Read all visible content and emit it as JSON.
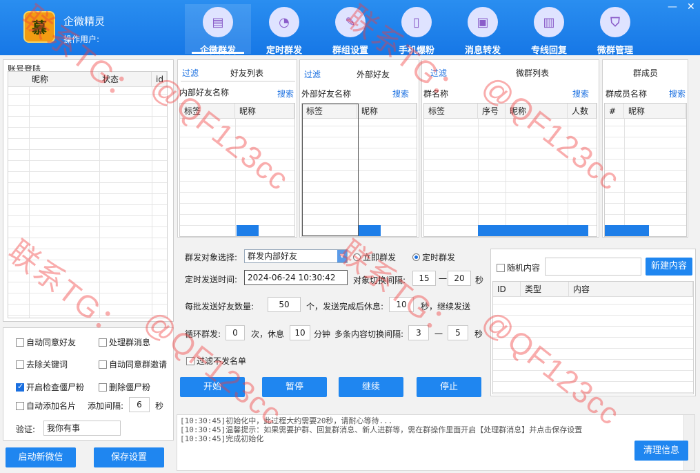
{
  "app": {
    "title": "企微精灵",
    "operator_label": "操作用户:",
    "logo_char": "慕"
  },
  "nav": [
    {
      "label": "企微群发",
      "icon": "phone-message-icon"
    },
    {
      "label": "定时群发",
      "icon": "clock-chart-icon"
    },
    {
      "label": "群组设置",
      "icon": "edit-document-icon"
    },
    {
      "label": "手机爆粉",
      "icon": "mobile-phone-icon"
    },
    {
      "label": "消息转发",
      "icon": "safe-box-icon"
    },
    {
      "label": "专线回复",
      "icon": "bar-chart-icon"
    },
    {
      "label": "微群管理",
      "icon": "shield-icon"
    }
  ],
  "window": {
    "minimize": "—",
    "close": "✕"
  },
  "accounts": {
    "title": "账号登陆",
    "columns": [
      "昵称",
      "状态",
      "id"
    ]
  },
  "options": {
    "auto_accept_friend": "自动同意好友",
    "handle_group_msg": "处理群消息",
    "remove_keywords": "去除关键词",
    "auto_accept_group": "自动同意群邀请",
    "check_zombie": "开启检查僵尸粉",
    "delete_zombie": "删除僵尸粉",
    "auto_add_card": "自动添加名片",
    "add_interval_label": "添加间隔:",
    "add_interval_value": "6",
    "add_interval_unit": "秒",
    "verify_label": "验证:",
    "verify_value": "我你有事",
    "start_wechat": "启动新微信",
    "save_settings": "保存设置"
  },
  "friends_panel": {
    "filter": "过滤",
    "title": "好友列表",
    "search_label": "内部好友名称",
    "search_btn": "搜索",
    "columns": [
      "标签",
      "昵称"
    ]
  },
  "external_panel": {
    "filter": "过滤",
    "title": "外部好友",
    "search_label": "外部好友名称",
    "search_btn": "搜索",
    "columns": [
      "标签",
      "昵称"
    ]
  },
  "groups_panel": {
    "filter": "过滤",
    "title": "微群列表",
    "search_label": "群名称",
    "search_btn": "搜索",
    "columns": [
      "标签",
      "序号",
      "昵称",
      "人数"
    ]
  },
  "members_panel": {
    "title": "群成员",
    "search_label": "群成员名称",
    "search_btn": "搜索",
    "columns": [
      "#",
      "昵称"
    ]
  },
  "send": {
    "target_label": "群发对象选择:",
    "target_value": "群发内部好友",
    "mode_now": "立即群发",
    "mode_timed": "定时群发",
    "timed_label": "定时发送时间:",
    "timed_value": "2024-06-24 10:30:42",
    "switch_label": "对象切换间隔:",
    "switch_min": "15",
    "switch_dash": "一",
    "switch_max": "20",
    "sec": "秒",
    "batch_label": "每批发送好友数量:",
    "batch_value": "50",
    "batch_after": "个，发送完成后休息:",
    "rest_value": "10",
    "rest_after": "秒，继续发送",
    "loop_label": "循环群发:",
    "loop_value": "0",
    "loop_unit": "次，休息",
    "loop_rest": "10",
    "loop_rest_unit": "分钟",
    "multi_label": "多条内容切换间隔:",
    "multi_min": "3",
    "multi_dash": "一",
    "multi_max": "5",
    "skip_blacklist": "过滤不发名单",
    "start": "开始",
    "pause": "暂停",
    "resume": "继续",
    "stop": "停止"
  },
  "content": {
    "random_label": "随机内容",
    "new_btn": "新建内容",
    "columns": [
      "ID",
      "类型",
      "内容"
    ]
  },
  "log": {
    "lines": [
      "[10:30:45]初始化中，此过程大约需要20秒，请耐心等待...",
      "[10:30:45]温馨提示：如果需要护群、回复群消息、新人进群等，需在群操作里面开启【处理群消息】并点击保存设置",
      "[10:30:45]完成初始化"
    ],
    "clear_btn": "清理信息"
  },
  "watermark": {
    "line1": "联系TG：",
    "line2": "@QF123cc"
  },
  "colors": {
    "header": "#1677e6",
    "accent": "#1f86f0",
    "watermark": "#f03c3c"
  }
}
